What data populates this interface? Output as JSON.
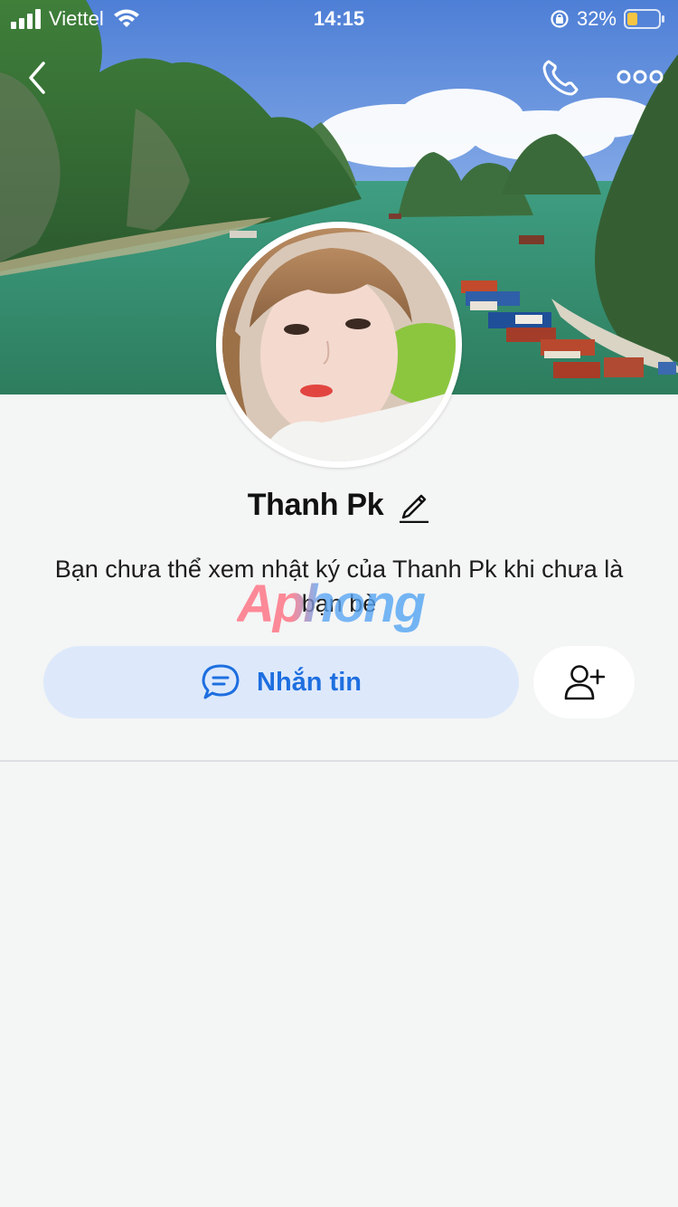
{
  "status_bar": {
    "carrier": "Viettel",
    "time": "14:15",
    "battery_percent": "32%",
    "battery_level": 0.32,
    "battery_color": "#f5c542"
  },
  "nav": {
    "back_icon": "chevron-left-icon",
    "call_icon": "phone-icon",
    "more_icon": "more-dots-icon"
  },
  "profile": {
    "name": "Thanh Pk",
    "edit_icon": "pencil-icon",
    "notice": "Bạn chưa thể xem nhật ký của Thanh Pk khi chưa là bạn bè"
  },
  "watermark": "Aphong",
  "actions": {
    "message_label": "Nhắn tin",
    "message_icon": "chat-bubble-icon",
    "add_friend_icon": "add-user-icon"
  },
  "colors": {
    "accent": "#1e6fe0",
    "message_button_bg": "#dde9fb",
    "page_bg": "#f4f5f5"
  }
}
